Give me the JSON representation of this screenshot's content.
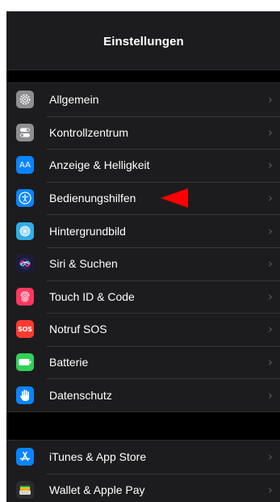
{
  "header": {
    "title": "Einstellungen"
  },
  "groups": [
    {
      "items": [
        {
          "label": "Allgemein",
          "icon": "gear-icon",
          "color": "#8e8e93"
        },
        {
          "label": "Kontrollzentrum",
          "icon": "toggles-icon",
          "color": "#8e8e93"
        },
        {
          "label": "Anzeige & Helligkeit",
          "icon": "display-brightness-icon",
          "color": "#0a84ff",
          "icon_text": "AA"
        },
        {
          "label": "Bedienungshilfen",
          "icon": "accessibility-icon",
          "color": "#0a84ff"
        },
        {
          "label": "Hintergrundbild",
          "icon": "wallpaper-flower-icon",
          "color": "#32ade6"
        },
        {
          "label": "Siri & Suchen",
          "icon": "siri-icon",
          "color": "#1c1c3a"
        },
        {
          "label": "Touch ID & Code",
          "icon": "fingerprint-icon",
          "color": "#ff375f"
        },
        {
          "label": "Notruf SOS",
          "icon": "sos-icon",
          "color": "#ff3b30",
          "icon_text": "SOS"
        },
        {
          "label": "Batterie",
          "icon": "battery-icon",
          "color": "#30d158"
        },
        {
          "label": "Datenschutz",
          "icon": "hand-icon",
          "color": "#0a84ff"
        }
      ]
    },
    {
      "items": [
        {
          "label": "iTunes & App Store",
          "icon": "app-store-icon",
          "color": "#0a84ff"
        },
        {
          "label": "Wallet & Apple Pay",
          "icon": "wallet-icon",
          "color": "#2c2c2e"
        }
      ]
    }
  ],
  "annotation": {
    "color": "#ff0000"
  },
  "chevron": "›"
}
